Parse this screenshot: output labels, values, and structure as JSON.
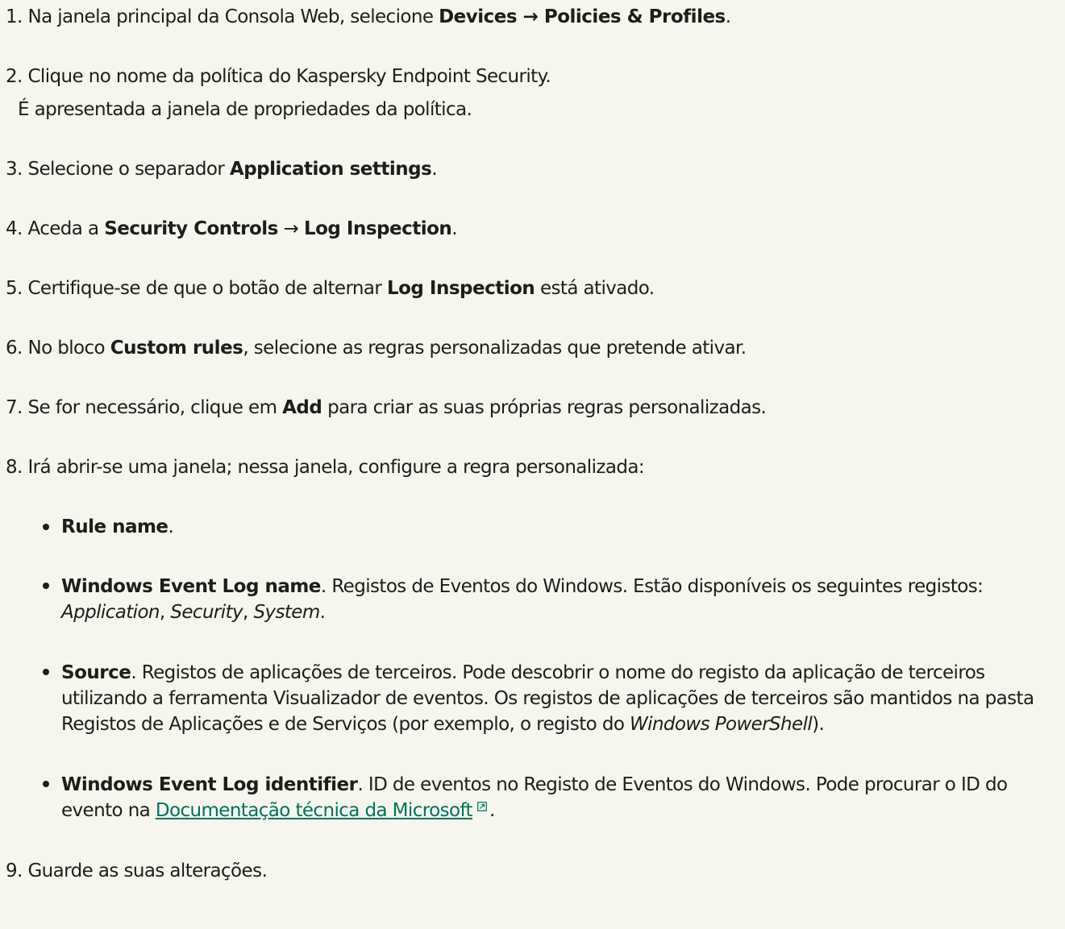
{
  "steps": [
    {
      "num": "1.",
      "parts": [
        {
          "t": " Na janela principal da Consola Web, selecione "
        },
        {
          "b": "Devices → Policies & Profiles"
        },
        {
          "t": "."
        }
      ]
    },
    {
      "num": "2.",
      "parts": [
        {
          "t": " Clique no nome da política do Kaspersky Endpoint Security."
        }
      ],
      "sub": "É apresentada a janela de propriedades da política."
    },
    {
      "num": "3.",
      "parts": [
        {
          "t": " Selecione o separador "
        },
        {
          "b": "Application settings"
        },
        {
          "t": "."
        }
      ]
    },
    {
      "num": "4.",
      "parts": [
        {
          "t": " Aceda a "
        },
        {
          "b": "Security Controls"
        },
        {
          "t": " → "
        },
        {
          "b": "Log Inspection"
        },
        {
          "t": "."
        }
      ]
    },
    {
      "num": "5.",
      "parts": [
        {
          "t": " Certifique-se de que o botão de alternar "
        },
        {
          "b": "Log Inspection"
        },
        {
          "t": " está ativado."
        }
      ]
    },
    {
      "num": "6.",
      "parts": [
        {
          "t": " No bloco "
        },
        {
          "b": "Custom rules"
        },
        {
          "t": ", selecione as regras personalizadas que pretende ativar."
        }
      ]
    },
    {
      "num": "7.",
      "parts": [
        {
          "t": " Se for necessário, clique em "
        },
        {
          "b": "Add"
        },
        {
          "t": " para criar as suas próprias regras personalizadas."
        }
      ]
    },
    {
      "num": "8.",
      "parts": [
        {
          "t": " Irá abrir-se uma janela; nessa janela, configure a regra personalizada:"
        }
      ],
      "bullets": [
        {
          "parts": [
            {
              "b": "Rule name"
            },
            {
              "t": "."
            }
          ]
        },
        {
          "parts": [
            {
              "b": "Windows Event Log name"
            },
            {
              "t": ". Registos de Eventos do Windows. Estão disponíveis os seguintes registos: "
            },
            {
              "i": "Application"
            },
            {
              "t": ", "
            },
            {
              "i": "Security"
            },
            {
              "t": ", "
            },
            {
              "i": "System"
            },
            {
              "t": "."
            }
          ]
        },
        {
          "parts": [
            {
              "b": "Source"
            },
            {
              "t": ". Registos de aplicações de terceiros. Pode descobrir o nome do registo da aplicação de terceiros utilizando a ferramenta Visualizador de eventos. Os registos de aplicações de terceiros são mantidos na pasta Registos de Aplicações e de Serviços (por exemplo, o registo do "
            },
            {
              "i": "Windows PowerShell"
            },
            {
              "t": ")."
            }
          ]
        },
        {
          "parts": [
            {
              "b": "Windows Event Log identifier"
            },
            {
              "t": ". ID de eventos no Registo de Eventos do Windows. Pode procurar o ID do evento na "
            },
            {
              "link": "Documentação técnica da Microsoft",
              "icon": "external-link-icon"
            },
            {
              "t": "."
            }
          ]
        }
      ]
    },
    {
      "num": "9.",
      "parts": [
        {
          "t": " Guarde as suas alterações."
        }
      ]
    }
  ],
  "colors": {
    "background": "#f6f5ee",
    "text": "#1d1d1b",
    "link": "#00715e"
  }
}
